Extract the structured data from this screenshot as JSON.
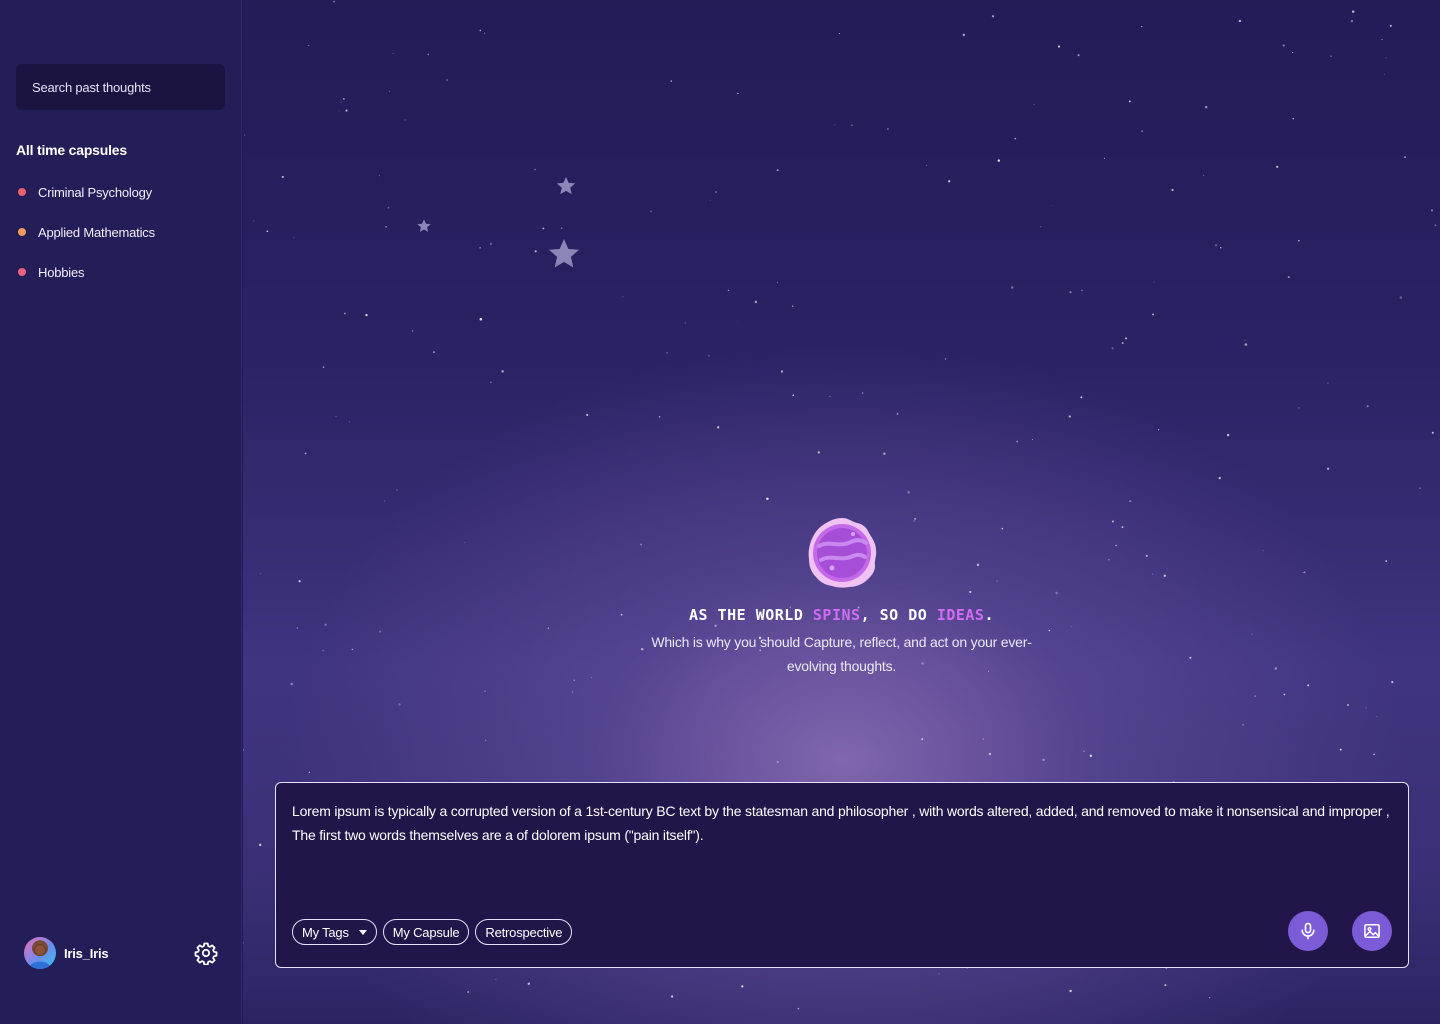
{
  "sidebar": {
    "search_placeholder": "Search past thoughts",
    "capsules_heading": "All time capsules",
    "capsules": [
      {
        "label": "Criminal Psychology",
        "color": "#f0606a"
      },
      {
        "label": "Applied Mathematics",
        "color": "#f29a5a"
      },
      {
        "label": "Hobbies",
        "color": "#f0607c"
      }
    ],
    "user": {
      "name": "Iris_Iris",
      "avatar_icon": "user-avatar",
      "settings_icon": "gear-icon"
    }
  },
  "hero": {
    "tagline_part1": "AS THE WORLD ",
    "tagline_accent1": "SPINS",
    "tagline_part2": ", SO DO ",
    "tagline_accent2": "IDEAS",
    "tagline_part3": ".",
    "subtitle": "Which is why you should Capture, reflect, and act on your ever-evolving thoughts.",
    "accent_color": "#d26cf2"
  },
  "composer": {
    "text": "Lorem ipsum is typically a corrupted version of a 1st-century BC text by the statesman and philosopher , with words altered, added, and removed to make it nonsensical and improper , The first two words themselves are a of dolorem ipsum (\"pain itself\").",
    "chips": {
      "tags": "My Tags",
      "capsule": "My Capsule",
      "retrospective": "Retrospective"
    },
    "mic_icon": "microphone-icon",
    "image_icon": "image-icon",
    "button_color": "#7c5cd6"
  }
}
